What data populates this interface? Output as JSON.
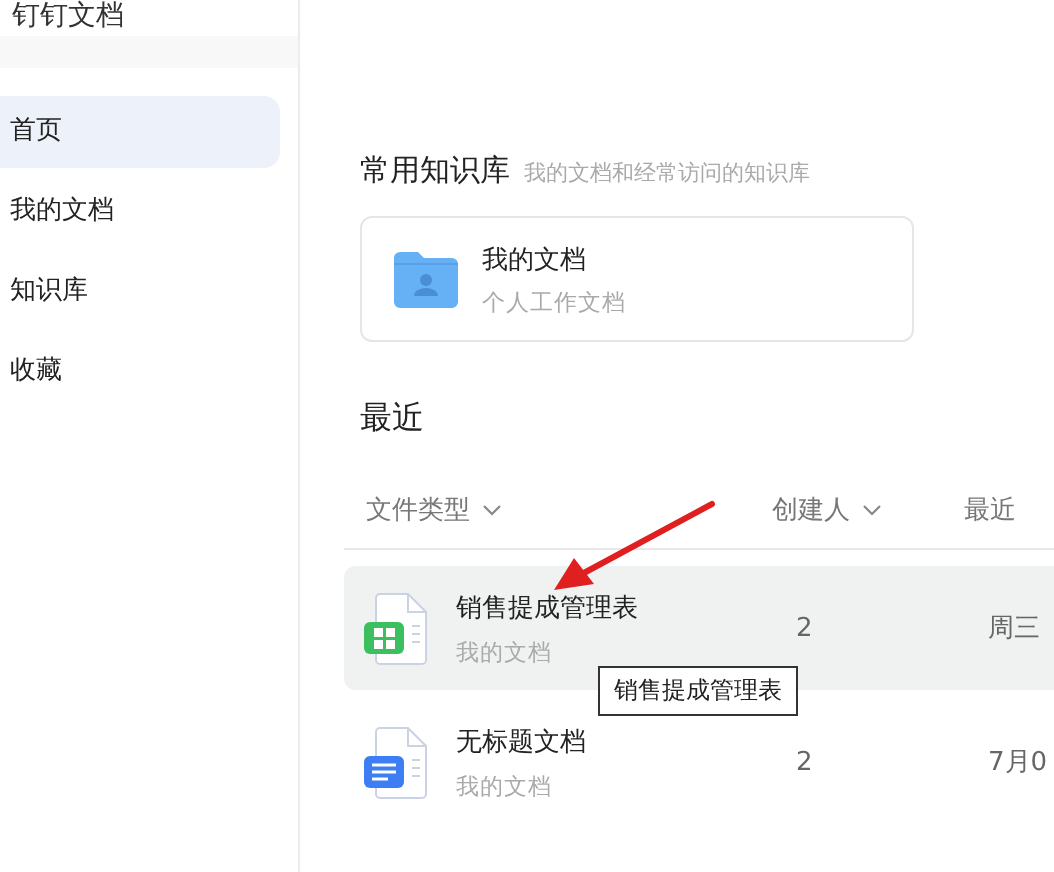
{
  "app": {
    "title": "钉钉文档"
  },
  "sidebar": {
    "items": [
      {
        "label": "首页",
        "selected": true
      },
      {
        "label": "我的文档",
        "selected": false
      },
      {
        "label": "知识库",
        "selected": false
      },
      {
        "label": "收藏",
        "selected": false
      }
    ]
  },
  "knowledge": {
    "title": "常用知识库",
    "subtitle": "我的文档和经常访问的知识库",
    "card": {
      "name": "我的文档",
      "description": "个人工作文档"
    }
  },
  "recent": {
    "title": "最近",
    "columns": [
      {
        "label": "文件类型",
        "dropdown": true
      },
      {
        "label": "创建人",
        "dropdown": true
      },
      {
        "label": "最近",
        "dropdown": false
      }
    ],
    "rows": [
      {
        "kind": "sheet",
        "name": "销售提成管理表",
        "location": "我的文档",
        "creator": "2",
        "date": "周三",
        "hovered": true
      },
      {
        "kind": "doc",
        "name": "无标题文档",
        "location": "我的文档",
        "creator": "2",
        "date": "7月0",
        "hovered": false
      }
    ]
  },
  "tooltip": {
    "text": "销售提成管理表"
  }
}
